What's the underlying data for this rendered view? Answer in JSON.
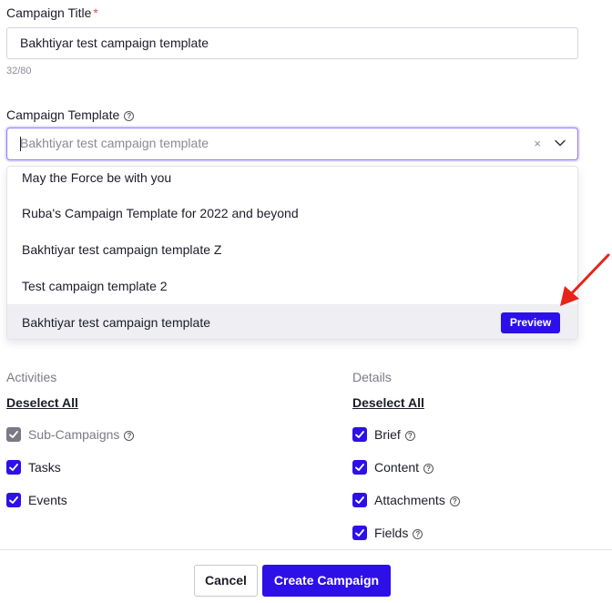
{
  "campaign_title": {
    "label": "Campaign Title",
    "required_mark": "*",
    "value": "Bakhtiyar test campaign template",
    "counter": "32/80"
  },
  "campaign_template": {
    "label": "Campaign Template",
    "help_icon": "?",
    "value": "Bakhtiyar test campaign template",
    "clear_icon": "×",
    "options": [
      {
        "label": "May the Force be with you"
      },
      {
        "label": "Ruba's Campaign Template for 2022 and beyond"
      },
      {
        "label": "Bakhtiyar test campaign template Z"
      },
      {
        "label": "Test campaign template 2"
      },
      {
        "label": "Bakhtiyar test campaign template",
        "preview_label": "Preview"
      }
    ]
  },
  "activities": {
    "title": "Activities",
    "deselect_all": "Deselect All",
    "items": [
      {
        "label": "Sub-Campaigns",
        "checked": true,
        "disabled": true
      },
      {
        "label": "Tasks",
        "checked": true
      },
      {
        "label": "Events",
        "checked": true
      }
    ]
  },
  "details": {
    "title": "Details",
    "deselect_all": "Deselect All",
    "items": [
      {
        "label": "Brief",
        "checked": true
      },
      {
        "label": "Content",
        "checked": true
      },
      {
        "label": "Attachments",
        "checked": true
      },
      {
        "label": "Fields",
        "checked": true
      }
    ]
  },
  "footer": {
    "cancel_label": "Cancel",
    "create_label": "Create Campaign"
  },
  "colors": {
    "accent": "#2d10e8",
    "required": "#e5484d",
    "annotation_arrow": "#e8231a"
  }
}
